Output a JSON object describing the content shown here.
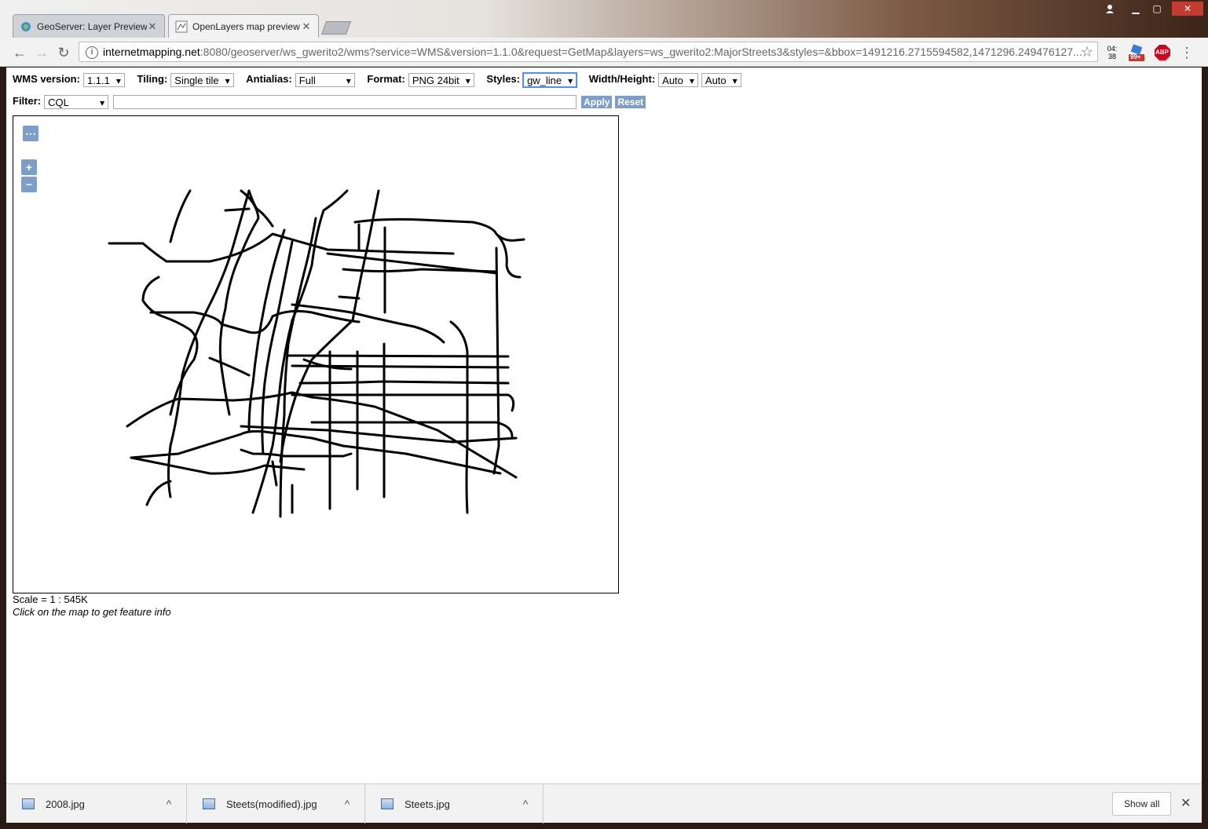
{
  "browser": {
    "tabs": [
      {
        "title": "GeoServer: Layer Preview",
        "active": false
      },
      {
        "title": "OpenLayers map preview",
        "active": true
      }
    ],
    "url_host": "internetmapping.net",
    "url_rest": ":8080/geoserver/ws_gwerito2/wms?service=WMS&version=1.1.0&request=GetMap&layers=ws_gwerito2:MajorStreets3&styles=&bbox=1491216.2715594582,1471296.249476127...",
    "ext_time": "04:\n38",
    "ext_badge": "99+",
    "ext_abp": "ABP"
  },
  "controls": {
    "wms_label": "WMS version:",
    "wms_value": "1.1.1",
    "tiling_label": "Tiling:",
    "tiling_value": "Single tile",
    "antialias_label": "Antialias:",
    "antialias_value": "Full",
    "format_label": "Format:",
    "format_value": "PNG 24bit",
    "styles_label": "Styles:",
    "styles_value": "gw_line",
    "wh_label": "Width/Height:",
    "width_value": "Auto",
    "height_value": "Auto",
    "filter_label": "Filter:",
    "filter_value": "CQL",
    "filter_text": "",
    "apply": "Apply",
    "reset": "Reset"
  },
  "map": {
    "menu_btn": "⋯",
    "zoom_in": "+",
    "zoom_out": "−",
    "layer": "ws_gwerito2:MajorStreets3"
  },
  "scale_text": "Scale = 1 : 545K",
  "hint_text": "Click on the map to get feature info",
  "downloads": [
    {
      "name": "2008.jpg"
    },
    {
      "name": "Steets(modified).jpg"
    },
    {
      "name": "Steets.jpg"
    }
  ],
  "show_all": "Show all"
}
